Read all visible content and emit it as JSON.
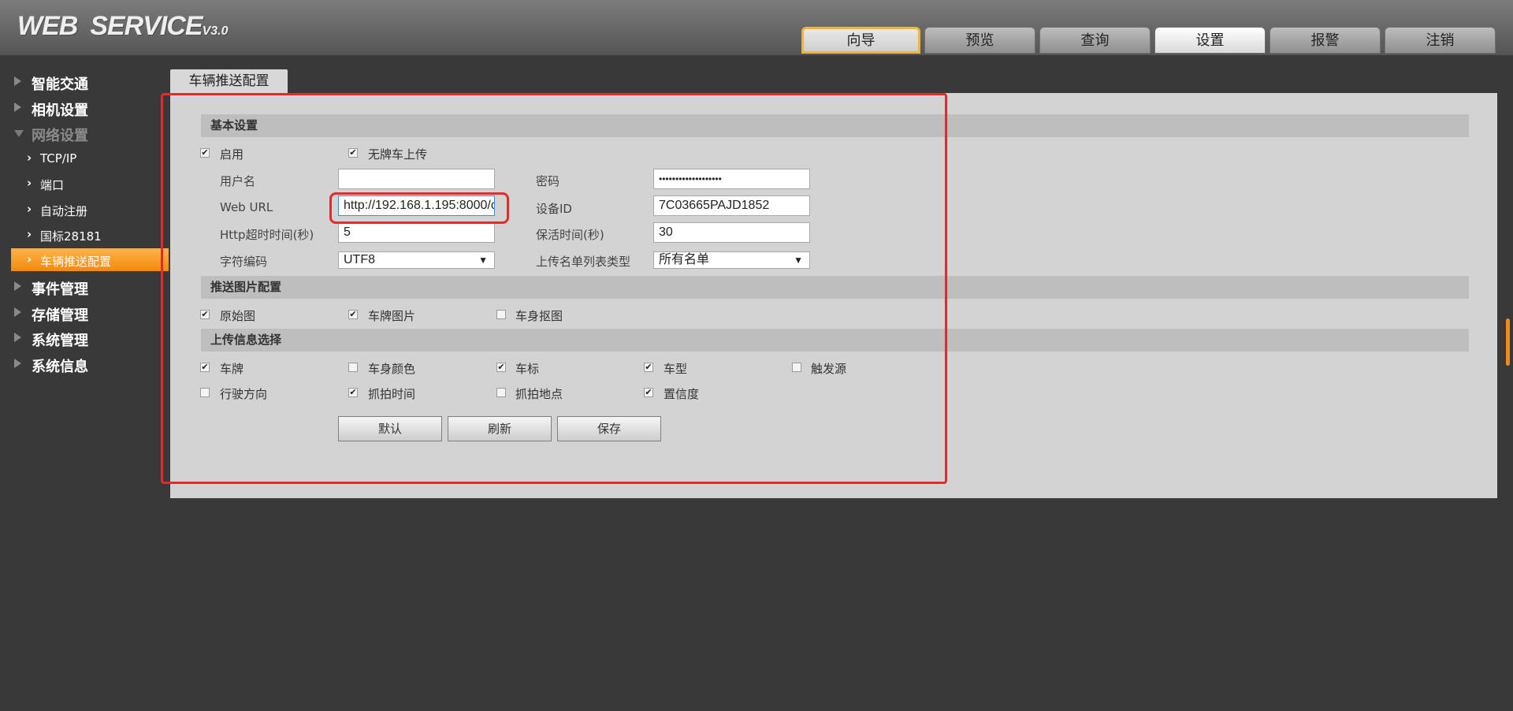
{
  "header": {
    "logo_main": "WEB",
    "logo_second": "SERVICE",
    "logo_version": "V3.0",
    "tabs": [
      "向导",
      "预览",
      "查询",
      "设置",
      "报警",
      "注销"
    ],
    "active_tab": "设置"
  },
  "sidebar": {
    "items": [
      "智能交通",
      "相机设置",
      "网络设置",
      "事件管理",
      "存储管理",
      "系统管理",
      "系统信息"
    ],
    "network_sub": [
      "TCP/IP",
      "端口",
      "自动注册",
      "国标28181",
      "车辆推送配置"
    ],
    "active_sub": "车辆推送配置"
  },
  "page": {
    "title_tab": "车辆推送配置",
    "sections": {
      "basic": "基本设置",
      "push_image": "推送图片配置",
      "upload_info": "上传信息选择"
    },
    "basic": {
      "enable_label": "启用",
      "enable_checked": true,
      "noplate_label": "无牌车上传",
      "noplate_checked": true,
      "username_label": "用户名",
      "username_value": "",
      "password_label": "密码",
      "password_value": "•••••••••••••••••••",
      "weburl_label": "Web URL",
      "weburl_value": "http://192.168.1.195:8000/c",
      "deviceid_label": "设备ID",
      "deviceid_value": "7C03665PAJD1852",
      "http_timeout_label": "Http超时时间(秒)",
      "http_timeout_value": "5",
      "keepalive_label": "保活时间(秒)",
      "keepalive_value": "30",
      "encoding_label": "字符编码",
      "encoding_value": "UTF8",
      "list_type_label": "上传名单列表类型",
      "list_type_value": "所有名单"
    },
    "push_image": [
      {
        "label": "原始图",
        "checked": true
      },
      {
        "label": "车牌图片",
        "checked": true
      },
      {
        "label": "车身抠图",
        "checked": false
      }
    ],
    "upload_info": [
      {
        "label": "车牌",
        "checked": true
      },
      {
        "label": "车身颜色",
        "checked": false
      },
      {
        "label": "车标",
        "checked": true
      },
      {
        "label": "车型",
        "checked": true
      },
      {
        "label": "触发源",
        "checked": false
      },
      {
        "label": "行驶方向",
        "checked": false
      },
      {
        "label": "抓拍时间",
        "checked": true
      },
      {
        "label": "抓拍地点",
        "checked": false
      },
      {
        "label": "置信度",
        "checked": true
      }
    ],
    "buttons": {
      "default": "默认",
      "refresh": "刷新",
      "save": "保存"
    }
  }
}
